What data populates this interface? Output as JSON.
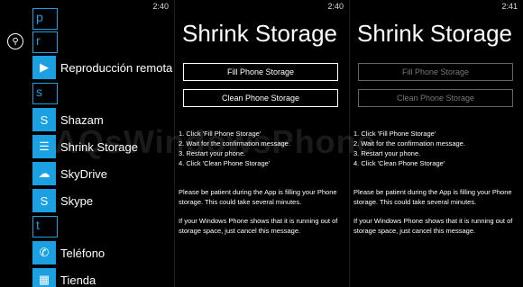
{
  "status": {
    "time_left": "2:40",
    "time_mid": "2:40",
    "time_right": "2:41"
  },
  "app_list": {
    "letters": [
      "p",
      "r",
      "s",
      "t"
    ],
    "apps": [
      {
        "label": "Reproducción remota",
        "icon": "play-icon"
      },
      {
        "label": "Shazam",
        "icon": "shazam-icon"
      },
      {
        "label": "Shrink Storage",
        "icon": "storage-icon"
      },
      {
        "label": "SkyDrive",
        "icon": "cloud-icon"
      },
      {
        "label": "Skype",
        "icon": "skype-icon"
      },
      {
        "label": "Teléfono",
        "icon": "phone-icon"
      },
      {
        "label": "Tienda",
        "icon": "store-icon"
      }
    ]
  },
  "shrink": {
    "title": "Shrink Storage",
    "fill_label": "Fill Phone Storage",
    "clean_label": "Clean Phone Storage",
    "steps": [
      "1. Click 'Fill Phone Storage'",
      "2. Wait for the confirmation message.",
      "3. Restart your phone.",
      "4. Click 'Clean Phone Storage'"
    ],
    "patience": "Please be patient during the App is filling your Phone storage. This could take several minutes.",
    "cancel_note": "If your Windows Phone shows that it is running out of storage space, just cancel this message."
  },
  "watermark": "AQsWindowsPhone"
}
